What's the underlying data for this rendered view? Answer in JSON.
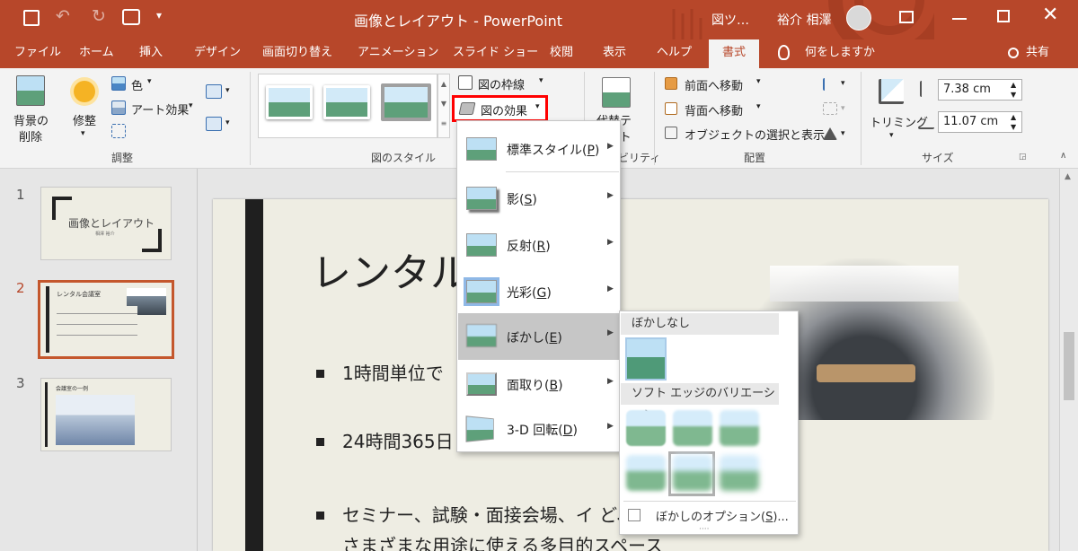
{
  "window": {
    "title": "画像とレイアウト  -  PowerPoint",
    "context_tab": "図ツ…",
    "user": "裕介 相澤"
  },
  "tabs": [
    "ファイル",
    "ホーム",
    "挿入",
    "デザイン",
    "画面切り替え",
    "アニメーション",
    "スライド ショー",
    "校閲",
    "表示",
    "ヘルプ",
    "書式"
  ],
  "active_tab": "書式",
  "tell_me": "何をしますか",
  "share": "共有",
  "ribbon": {
    "remove_bg": [
      "背景の",
      "削除"
    ],
    "corrections": "修整",
    "color": "色",
    "artistic": "アート効果",
    "group_adjust": "調整",
    "group_styles": "図のスタイル",
    "border": "図の枠線",
    "effects": "図の効果",
    "alt_text": [
      "代替テ",
      "キスト"
    ],
    "accessibility_partial": "ビリティ",
    "bring_forward": "前面へ移動",
    "send_backward": "背面へ移動",
    "selection_pane": "オブジェクトの選択と表示",
    "group_arrange": "配置",
    "crop": "トリミング",
    "height": "7.38 cm",
    "width": "11.07 cm",
    "group_size": "サイズ"
  },
  "effects_menu": [
    {
      "label": "標準スタイル(",
      "key": "P",
      "end": ")"
    },
    {
      "label": "影(",
      "key": "S",
      "end": ")"
    },
    {
      "label": "反射(",
      "key": "R",
      "end": ")"
    },
    {
      "label": "光彩(",
      "key": "G",
      "end": ")"
    },
    {
      "label": "ぼかし(",
      "key": "E",
      "end": ")"
    },
    {
      "label": "面取り(",
      "key": "B",
      "end": ")"
    },
    {
      "label": "3-D 回転(",
      "key": "D",
      "end": ")"
    }
  ],
  "soft_edges": {
    "none_header": "ぼかしなし",
    "variations_header": "ソフト エッジのバリエーション",
    "options_label": "ぼかしのオプション(",
    "options_key": "S",
    "options_end": ")..."
  },
  "slides": [
    {
      "num": "1",
      "title": "画像とレイアウト",
      "sub": "相澤 裕介"
    },
    {
      "num": "2",
      "title": "レンタル会議室"
    },
    {
      "num": "3",
      "title": "会議室の一例"
    }
  ],
  "slide": {
    "title": "レンタル",
    "bullets": [
      "1時間単位で",
      "24時間365日",
      "セミナー、試験・面接会場、イ                                 ど、"
    ],
    "bullet_cont": "さまざまな用途に使える多目的スペース"
  },
  "colors": {
    "accent": "#b7472a",
    "highlight": "#ff0000"
  }
}
